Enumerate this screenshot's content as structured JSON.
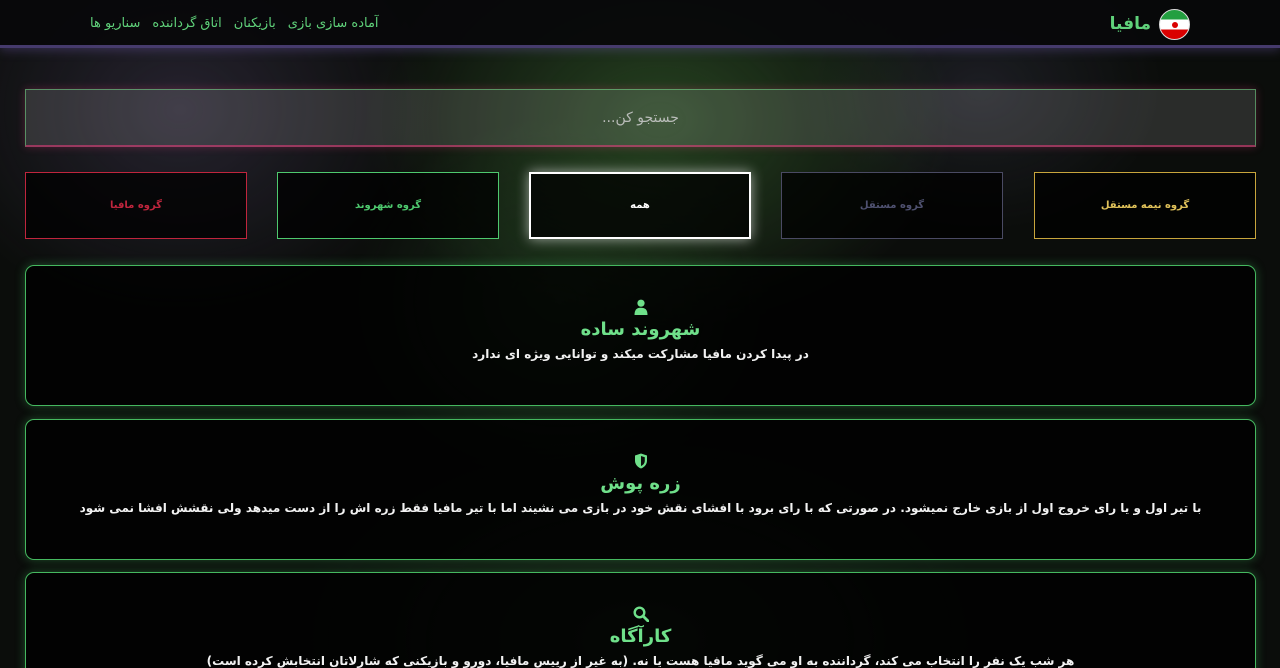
{
  "nav": {
    "brand": "مافیا",
    "links": [
      "سناریو ها",
      "اتاق گرداننده",
      "بازیکنان",
      "آماده سازی بازی"
    ]
  },
  "search": {
    "placeholder": "جستجو کن..."
  },
  "filters": {
    "mafia": "گروه مافیا",
    "citizen": "گروه شهروند",
    "all": "همه",
    "independent": "گروه مستقل",
    "semi_independent": "گروه نیمه مستقل"
  },
  "roles": [
    {
      "icon": "user-icon",
      "title": "شهروند ساده",
      "description": "در پیدا کردن مافیا مشارکت میکند و توانایی ویژه ای ندارد"
    },
    {
      "icon": "shield-icon",
      "title": "زره پوش",
      "description": "با تیر اول و یا رای خروج اول از بازی خارج نمیشود. در صورتی که با رای برود با افشای نقش خود در بازی می نشیند اما با تیر مافیا فقط زره اش را از دست میدهد ولی نقشش افشا نمی شود"
    },
    {
      "icon": "search-icon",
      "title": "کارآگاه",
      "description": "هر شب یک نفر را انتخاب می کند، گرداننده به او می گوید مافیا هست یا نه. (به غیر از رییس مافیا، دورو و بازیکنی که شارلاتان انتخابش کرده است)"
    }
  ],
  "colors": {
    "accent_green": "#5fd17a",
    "mafia_red": "#c0253d",
    "independent_gray": "#4f5170",
    "semi_gold": "#e0c25a"
  }
}
